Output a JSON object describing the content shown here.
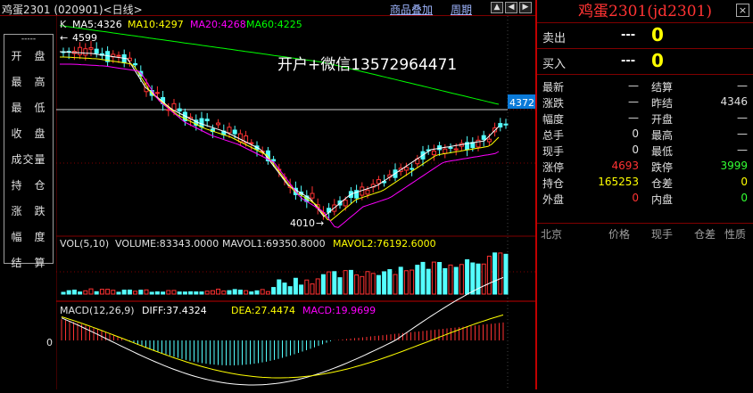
{
  "topbar": {
    "title": "鸡蛋2301 (020901)<日线>",
    "overlay_label": "商品叠加",
    "period_label": "周期"
  },
  "sidebar": {
    "top_dash": "-----",
    "items": [
      {
        "label": "开　盘"
      },
      {
        "label": "最　高"
      },
      {
        "label": "最　低"
      },
      {
        "label": "收　盘"
      },
      {
        "label": "成交量"
      },
      {
        "label": "持　仓"
      },
      {
        "label": "涨　跌"
      },
      {
        "label": "幅　度"
      },
      {
        "label": "结　算"
      }
    ]
  },
  "main_chart": {
    "k_label": "K",
    "ma5": "MA5:4326",
    "ma10": "MA10:4297",
    "ma20": "MA20:4268",
    "ma60": "MA60:4225",
    "high_marker": "4599",
    "low_marker": "4010",
    "price_tag": "4372",
    "watermark": "开户+微信13572964471",
    "colors": {
      "ma5": "#ffffff",
      "ma10": "#ffff00",
      "ma20": "#ff00ff",
      "ma60": "#00ff00",
      "up": "#ff3232",
      "down": "#54ffff"
    }
  },
  "volume_chart": {
    "label": "VOL(5,10)",
    "volume": "VOLUME:83343.0000",
    "mavol1": "MAVOL1:69350.8000",
    "mavol2": "MAVOL2:76192.6000"
  },
  "macd_chart": {
    "label": "MACD(12,26,9)",
    "diff": "DIFF:37.4324",
    "dea": "DEA:27.4474",
    "macd": "MACD:19.9699",
    "zero_label": "0"
  },
  "quote": {
    "title": "鸡蛋2301(jd2301)",
    "sell_label": "卖出",
    "sell_price": "---",
    "sell_vol": "0",
    "buy_label": "买入",
    "buy_price": "---",
    "buy_vol": "0",
    "rows": [
      {
        "l1": "最新",
        "v1": "—",
        "c1": "#e0e0e0",
        "l2": "结算",
        "v2": "—",
        "c2": "#e0e0e0"
      },
      {
        "l1": "涨跌",
        "v1": "—",
        "c1": "#e0e0e0",
        "l2": "昨结",
        "v2": "4346",
        "c2": "#e0e0e0"
      },
      {
        "l1": "幅度",
        "v1": "—",
        "c1": "#e0e0e0",
        "l2": "开盘",
        "v2": "—",
        "c2": "#e0e0e0"
      },
      {
        "l1": "总手",
        "v1": "0",
        "c1": "#e0e0e0",
        "l2": "最高",
        "v2": "—",
        "c2": "#e0e0e0"
      },
      {
        "l1": "现手",
        "v1": "0",
        "c1": "#e0e0e0",
        "l2": "最低",
        "v2": "—",
        "c2": "#e0e0e0"
      },
      {
        "l1": "涨停",
        "v1": "4693",
        "c1": "#ff3333",
        "l2": "跌停",
        "v2": "3999",
        "c2": "#33ff33"
      },
      {
        "l1": "持仓",
        "v1": "165253",
        "c1": "#ffff00",
        "l2": "仓差",
        "v2": "0",
        "c2": "#ffff00"
      },
      {
        "l1": "外盘",
        "v1": "0",
        "c1": "#ff3333",
        "l2": "内盘",
        "v2": "0",
        "c2": "#33ff33"
      }
    ],
    "trade_headers": [
      "北京",
      "价格",
      "现手",
      "仓差",
      "性质"
    ]
  }
}
